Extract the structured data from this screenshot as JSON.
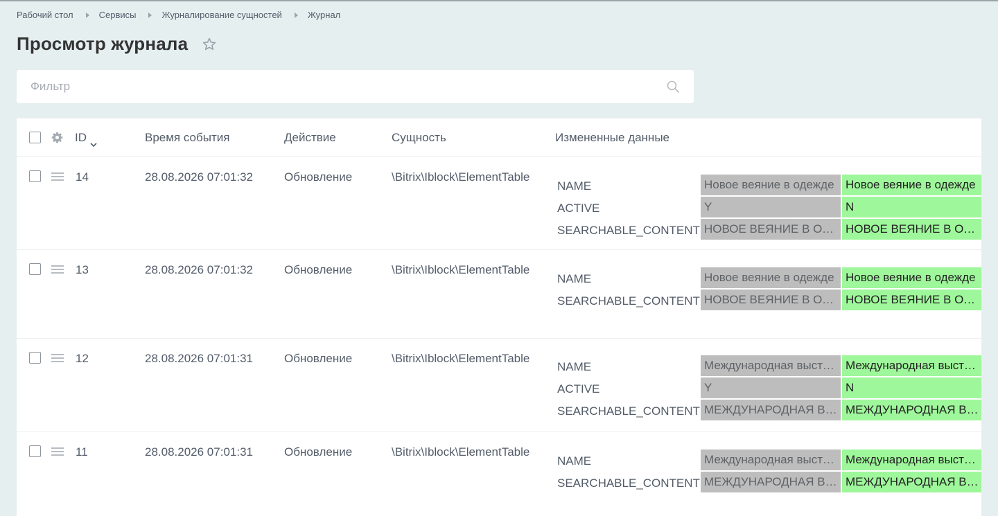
{
  "breadcrumb": [
    "Рабочий стол",
    "Сервисы",
    "Журналирование сущностей",
    "Журнал"
  ],
  "page_title": "Просмотр журнала",
  "filter": {
    "placeholder": "Фильтр"
  },
  "columns": {
    "id": "ID",
    "time": "Время события",
    "action": "Действие",
    "entity": "Сущность",
    "changes": "Измененные данные"
  },
  "rows": [
    {
      "id": "14",
      "time": "28.08.2026 07:01:32",
      "action": "Обновление",
      "entity": "\\Bitrix\\Iblock\\ElementTable",
      "changes": [
        {
          "field": "NAME",
          "old": "Новое веяние в одежде",
          "new": "Новое веяние в одежде"
        },
        {
          "field": "ACTIVE",
          "old": "Y",
          "new": "N"
        },
        {
          "field": "SEARCHABLE_CONTENT",
          "old": "НОВОЕ ВЕЯНИЕ В ОДЕЖДЕ",
          "new": "НОВОЕ ВЕЯНИЕ В ОДЕЖДЕ"
        }
      ]
    },
    {
      "id": "13",
      "time": "28.08.2026 07:01:32",
      "action": "Обновление",
      "entity": "\\Bitrix\\Iblock\\ElementTable",
      "changes": [
        {
          "field": "NAME",
          "old": "Новое веяние в одежде",
          "new": "Новое веяние в одежде"
        },
        {
          "field": "SEARCHABLE_CONTENT",
          "old": "НОВОЕ ВЕЯНИЕ В ОДЕЖДЕ",
          "new": "НОВОЕ ВЕЯНИЕ В ОДЕЖДЕ"
        }
      ]
    },
    {
      "id": "12",
      "time": "28.08.2026 07:01:31",
      "action": "Обновление",
      "entity": "\\Bitrix\\Iblock\\ElementTable",
      "changes": [
        {
          "field": "NAME",
          "old": "Международная выставка",
          "new": "Международная выставка"
        },
        {
          "field": "ACTIVE",
          "old": "Y",
          "new": "N"
        },
        {
          "field": "SEARCHABLE_CONTENT",
          "old": "МЕЖДУНАРОДНАЯ ВЫСТАВКА",
          "new": "МЕЖДУНАРОДНАЯ ВЫСТАВКА"
        }
      ]
    },
    {
      "id": "11",
      "time": "28.08.2026 07:01:31",
      "action": "Обновление",
      "entity": "\\Bitrix\\Iblock\\ElementTable",
      "changes": [
        {
          "field": "NAME",
          "old": "Международная выставка",
          "new": "Международная выставка"
        },
        {
          "field": "SEARCHABLE_CONTENT",
          "old": "МЕЖДУНАРОДНАЯ ВЫСТАВКА",
          "new": "МЕЖДУНАРОДНАЯ ВЫСТАВКА"
        }
      ]
    }
  ],
  "colors": {
    "old_value_bg": "#bdbdbd",
    "new_value_bg": "#9ef79a",
    "page_bg": "#e6eff0"
  }
}
